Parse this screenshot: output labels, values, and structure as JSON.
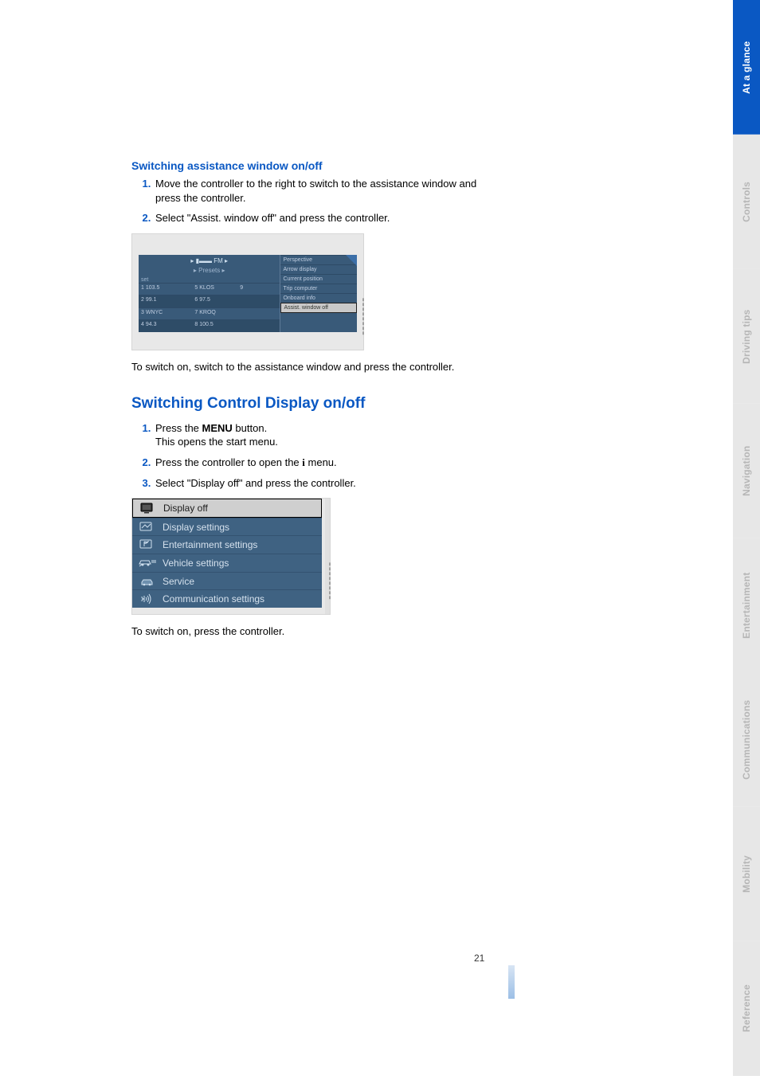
{
  "side_tabs": [
    {
      "label": "At a glance",
      "active": true
    },
    {
      "label": "Controls",
      "active": false
    },
    {
      "label": "Driving tips",
      "active": false
    },
    {
      "label": "Navigation",
      "active": false
    },
    {
      "label": "Entertainment",
      "active": false
    },
    {
      "label": "Communications",
      "active": false
    },
    {
      "label": "Mobility",
      "active": false
    },
    {
      "label": "Reference",
      "active": false
    }
  ],
  "section1": {
    "heading": "Switching assistance window on/off",
    "steps": [
      "Move the controller to the right to switch to the assistance window and press the controller.",
      "Select \"Assist. window off\" and press the controller."
    ],
    "after": "To switch on, switch to the assistance window and press the controller."
  },
  "img1": {
    "band": "FM",
    "subtitle": "Presets",
    "set_label": "set",
    "presets": [
      [
        "1 103.5",
        "5 KLOS",
        "9"
      ],
      [
        "2 99.1",
        "6 97.5",
        ""
      ],
      [
        "3 WNYC",
        "7 KROQ",
        ""
      ],
      [
        "4 94.3",
        "8 100.5",
        ""
      ]
    ],
    "right_items": [
      "Perspective",
      "Arrow display",
      "Current position",
      "Trip computer",
      "Onboard info",
      "Assist. window off"
    ],
    "right_selected_index": 5
  },
  "section2": {
    "heading": "Switching Control Display on/off",
    "step1_pre": "Press the ",
    "step1_menu": "MENU",
    "step1_post": " button.",
    "step1_line2": "This opens the start menu.",
    "step2_pre": "Press the controller to open the ",
    "step2_icon": "i",
    "step2_post": " menu.",
    "step3": "Select \"Display off\" and press the controller.",
    "after": "To switch on, press the controller."
  },
  "img2": {
    "items": [
      {
        "label": "Display off",
        "selected": true
      },
      {
        "label": "Display settings",
        "selected": false
      },
      {
        "label": "Entertainment settings",
        "selected": false
      },
      {
        "label": "Vehicle settings",
        "selected": false
      },
      {
        "label": "Service",
        "selected": false
      },
      {
        "label": "Communication settings",
        "selected": false
      }
    ]
  },
  "page_number": "21"
}
